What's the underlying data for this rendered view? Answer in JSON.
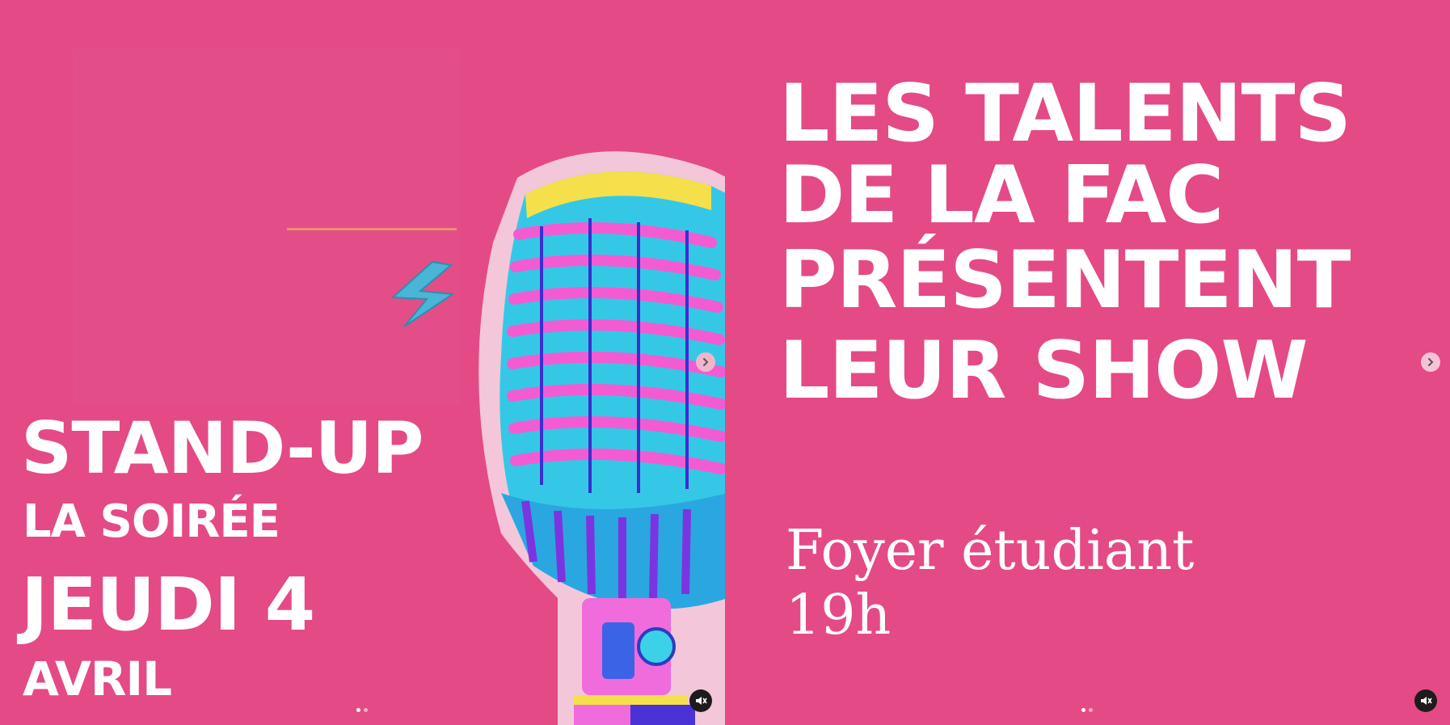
{
  "slides": [
    {
      "title": "STAND-UP",
      "subtitle": "LA SOIRÉE",
      "day": "JEUDI 4",
      "month": "AVRIL"
    },
    {
      "headline": [
        "LES TALENTS",
        "DE LA FAC",
        "PRÉSENTENT",
        "LEUR SHOW"
      ],
      "venue": "Foyer étudiant",
      "time": "19h"
    }
  ],
  "colors": {
    "background": "#e44a86",
    "text": "#ffffff"
  },
  "icons": {
    "next": "chevron-right-icon",
    "mute": "speaker-muted-icon",
    "mic": "microphone-illustration",
    "bolt": "lightning-icon"
  }
}
